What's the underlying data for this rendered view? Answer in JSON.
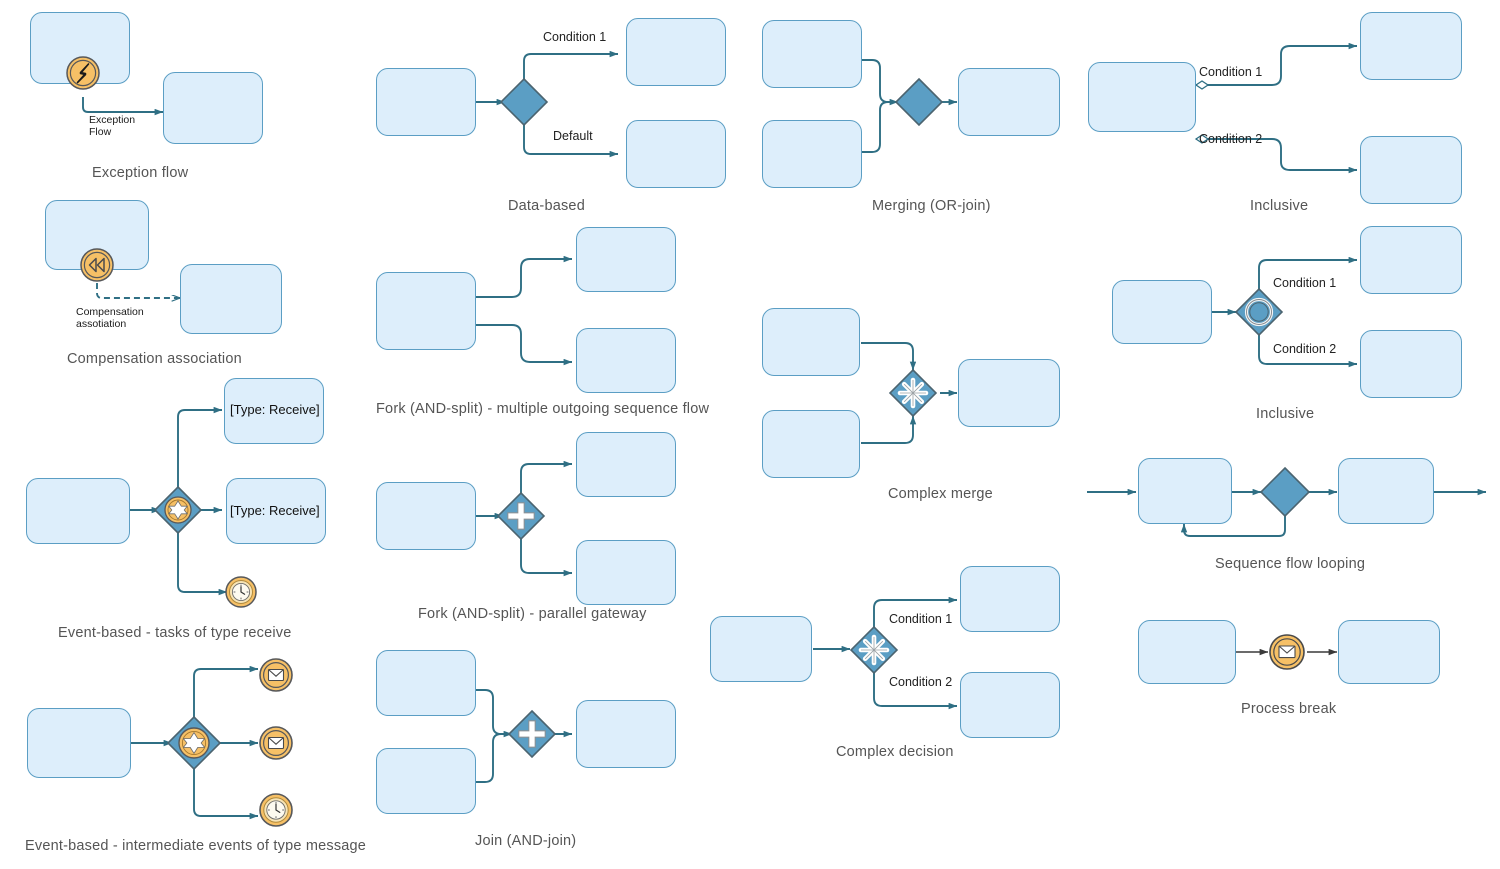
{
  "page": {
    "title": "BPMN 2.0 sequence flow and gateway patterns",
    "background": "#ffffff"
  },
  "colors": {
    "task_fill": "#ddeefb",
    "task_stroke": "#5b9ec4",
    "gateway_fill": "#5b9ec4",
    "gateway_stroke": "#4b6470",
    "event_fill": "#f6c066",
    "event_stroke": "#57585a",
    "connector": "#2f6f84",
    "caption_text": "#555555",
    "label_text": "#222222"
  },
  "patterns": [
    {
      "id": "exception-flow",
      "caption": "Exception flow",
      "edge_labels": [
        "Exception",
        "Flow"
      ],
      "event_icon": "error-event-icon",
      "tasks": 2
    },
    {
      "id": "compensation-association",
      "caption": "Compensation association",
      "edge_labels": [
        "Compensation",
        "assotiation"
      ],
      "event_icon": "compensation-event-icon",
      "tasks": 2
    },
    {
      "id": "event-based-receive",
      "caption": "Event-based - tasks of type receive",
      "task_labels": [
        "[Type: Receive]",
        "[Type: Receive]"
      ],
      "gateway_icon": "event-based-gateway-icon",
      "event_icon": "timer-event-icon",
      "tasks": 3
    },
    {
      "id": "event-based-message",
      "caption": "Event-based - intermediate events of type message",
      "gateway_icon": "event-based-gateway-icon",
      "event_icons": [
        "message-event-icon",
        "message-event-icon",
        "timer-event-icon"
      ],
      "tasks": 1
    },
    {
      "id": "data-based",
      "caption": "Data-based",
      "edge_labels": [
        "Condition 1",
        "Default"
      ],
      "gateway_icon": "exclusive-gateway-icon",
      "tasks": 3
    },
    {
      "id": "fork-and-split-multiple",
      "caption": "Fork (AND-split) - multiple outgoing sequence flow",
      "tasks": 3
    },
    {
      "id": "fork-and-split-parallel",
      "caption": "Fork (AND-split) - parallel gateway",
      "gateway_icon": "parallel-gateway-icon",
      "tasks": 3
    },
    {
      "id": "join-and-join",
      "caption": "Join (AND-join)",
      "gateway_icon": "parallel-gateway-icon",
      "tasks": 3
    },
    {
      "id": "merging-or-join",
      "caption": "Merging (OR-join)",
      "gateway_icon": "exclusive-gateway-icon",
      "tasks": 3
    },
    {
      "id": "complex-merge",
      "caption": "Complex merge",
      "gateway_icon": "complex-gateway-icon",
      "tasks": 3
    },
    {
      "id": "complex-decision",
      "caption": "Complex decision",
      "edge_labels": [
        "Condition 1",
        "Condition 2"
      ],
      "gateway_icon": "complex-gateway-icon",
      "tasks": 3
    },
    {
      "id": "inclusive-conditional-flow",
      "caption": "Inclusive",
      "edge_labels": [
        "Condition 1",
        "Condition 2"
      ],
      "marker": "conditional-flow-diamond-marker",
      "tasks": 3
    },
    {
      "id": "inclusive-gateway",
      "caption": "Inclusive",
      "edge_labels": [
        "Condition 1",
        "Condition 2"
      ],
      "gateway_icon": "inclusive-gateway-icon",
      "tasks": 3
    },
    {
      "id": "sequence-flow-looping",
      "caption": "Sequence flow looping",
      "gateway_icon": "exclusive-gateway-icon",
      "tasks": 2
    },
    {
      "id": "process-break",
      "caption": "Process break",
      "event_icon": "message-event-icon",
      "tasks": 2
    }
  ],
  "captions": {
    "exception_flow": "Exception flow",
    "compensation_association": "Compensation association",
    "event_based_receive": "Event-based - tasks of type receive",
    "event_based_message": "Event-based - intermediate events of type message",
    "data_based": "Data-based",
    "fork_multiple": "Fork (AND-split) - multiple outgoing sequence flow",
    "fork_parallel": "Fork (AND-split) - parallel gateway",
    "join": "Join (AND-join)",
    "merging": "Merging (OR-join)",
    "complex_merge": "Complex merge",
    "complex_decision": "Complex decision",
    "inclusive_1": "Inclusive",
    "inclusive_2": "Inclusive",
    "looping": "Sequence flow looping",
    "process_break": "Process break"
  },
  "labels": {
    "exception_line1": "Exception",
    "exception_line2": "Flow",
    "compensation_line1": "Compensation",
    "compensation_line2": "assotiation",
    "condition_1": "Condition 1",
    "default": "Default",
    "complex_condition_1": "Condition 1",
    "complex_condition_2": "Condition 2",
    "inclusive1_condition_1": "Condition 1",
    "inclusive1_condition_2": "Condition 2",
    "inclusive2_condition_1": "Condition 1",
    "inclusive2_condition_2": "Condition 2",
    "type_receive_1": "[Type: Receive]",
    "type_receive_2": "[Type: Receive]"
  }
}
